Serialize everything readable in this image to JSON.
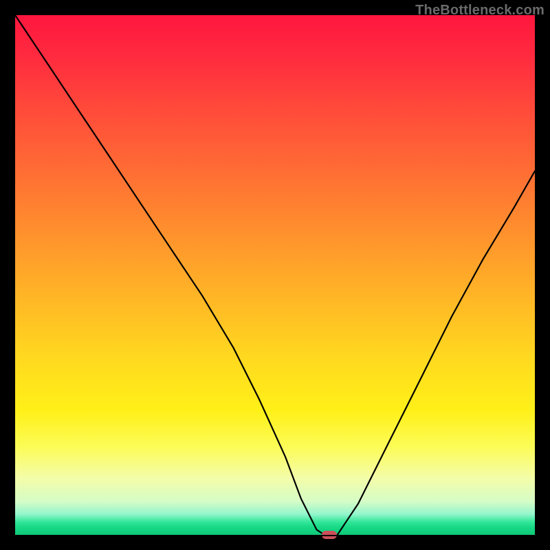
{
  "watermark": "TheBottleneck.com",
  "colors": {
    "frame": "#000000",
    "curve": "#000000",
    "marker": "#cc4f5a",
    "gradient_top": "#ff163e",
    "gradient_bottom": "#0fc878"
  },
  "chart_data": {
    "type": "line",
    "title": "",
    "xlabel": "",
    "ylabel": "",
    "xlim": [
      0,
      100
    ],
    "ylim": [
      0,
      100
    ],
    "series": [
      {
        "name": "bottleneck-curve",
        "x": [
          0,
          6,
          12,
          18,
          24,
          30,
          36,
          42,
          47,
          52,
          55,
          58,
          59.5,
          62,
          66,
          72,
          78,
          84,
          90,
          96,
          100
        ],
        "values": [
          100,
          91,
          82,
          73,
          64,
          55,
          46,
          36,
          26,
          15,
          7,
          1,
          0,
          0,
          6,
          18,
          30,
          42,
          53,
          63,
          70
        ]
      }
    ],
    "marker": {
      "x": 60.5,
      "y": 0
    },
    "annotations": []
  }
}
